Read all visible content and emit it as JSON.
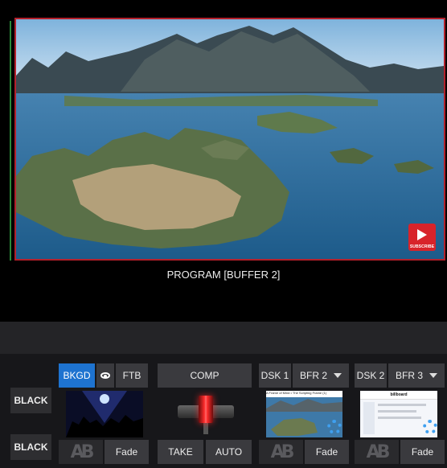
{
  "program": {
    "label": "PROGRAM [BUFFER 2]",
    "badge_caption": "SUBSCRIBE"
  },
  "black_buttons": [
    "BLACK",
    "BLACK"
  ],
  "background": {
    "bkgd_label": "BKGD",
    "preview_icon": "eye-icon",
    "ftb_label": "FTB",
    "transition_label": "Fade"
  },
  "comp": {
    "label": "COMP",
    "take_label": "TAKE",
    "auto_label": "AUTO"
  },
  "dsk1": {
    "label": "DSK 1",
    "source_label": "BFR 2",
    "transition_label": "Fade",
    "thumb_title": "A Frame of Mind • The Scripting Frame (1)"
  },
  "dsk2": {
    "label": "DSK 2",
    "source_label": "BFR 3",
    "transition_label": "Fade",
    "thumb_title": "billboard"
  },
  "colors": {
    "accent": "#1e73d0",
    "program_border": "#b3202b",
    "button_bg": "#3a3a3e"
  }
}
